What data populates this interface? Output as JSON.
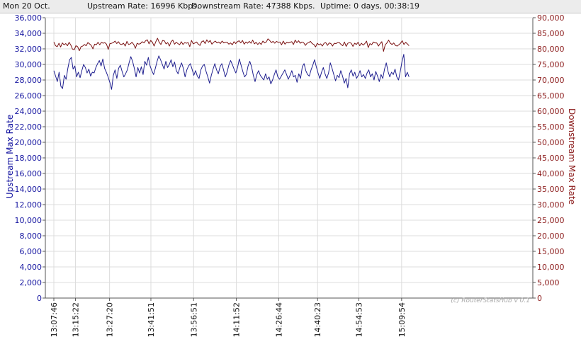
{
  "status": {
    "date": "Mon 20 Oct.",
    "upstream": "Upstream Rate: 16996 Kbps.",
    "downstream": "Downstream Rate: 47388 Kbps.",
    "uptime": "Uptime: 0 days, 00:38:19"
  },
  "credit": "(c) RouterStatsHub v 0.1",
  "colors": {
    "upstream": "#1f1f8f",
    "downstream": "#7a1010",
    "grid": "#dcdcdc"
  },
  "chart_data": {
    "type": "line",
    "title": "",
    "xlabel": "",
    "ylabel_left": "Upstream Max Rate",
    "ylabel_right": "Downstream Max Rate",
    "ylim_left": [
      0,
      36000
    ],
    "ylim_right": [
      0,
      90000
    ],
    "left_ticks": [
      "0",
      "2,000",
      "4,000",
      "6,000",
      "8,000",
      "10,000",
      "12,000",
      "14,000",
      "16,000",
      "18,000",
      "20,000",
      "22,000",
      "24,000",
      "26,000",
      "28,000",
      "30,000",
      "32,000",
      "34,000",
      "36,000"
    ],
    "right_ticks": [
      "0",
      "5,000",
      "10,000",
      "15,000",
      "20,000",
      "25,000",
      "30,000",
      "35,000",
      "40,000",
      "45,000",
      "50,000",
      "55,000",
      "60,000",
      "65,000",
      "70,000",
      "75,000",
      "80,000",
      "85,000",
      "90,000"
    ],
    "x_ticks": [
      "13:07:46",
      "13:15:22",
      "13:27:20",
      "13:41:51",
      "13:56:51",
      "14:11:52",
      "14:26:44",
      "14:40:23",
      "14:54:53",
      "15:09:54"
    ],
    "grid": true,
    "series": [
      {
        "name": "Upstream Max Rate",
        "axis": "left",
        "x_start": "13:07:46",
        "x_end": "15:12:30",
        "values": [
          29200,
          28500,
          27800,
          29000,
          27200,
          26900,
          28600,
          28100,
          29500,
          30600,
          30900,
          29400,
          29800,
          28400,
          29000,
          28300,
          29200,
          30000,
          29600,
          28900,
          29400,
          28500,
          29000,
          28900,
          29600,
          30100,
          30500,
          29800,
          30700,
          29500,
          29000,
          28400,
          27700,
          26800,
          28600,
          29300,
          28200,
          29500,
          29900,
          29100,
          28400,
          28800,
          29300,
          30200,
          31000,
          30400,
          29500,
          28400,
          29600,
          28900,
          29700,
          28700,
          30400,
          29900,
          30900,
          29800,
          29200,
          28700,
          29500,
          30400,
          31100,
          30600,
          30000,
          29400,
          30400,
          29600,
          30000,
          30600,
          29700,
          30300,
          29200,
          28800,
          29600,
          30200,
          29500,
          28400,
          29300,
          29800,
          30100,
          29400,
          28600,
          29200,
          28500,
          28200,
          29300,
          29800,
          30000,
          29100,
          28400,
          27600,
          28600,
          29400,
          30100,
          29300,
          28800,
          29700,
          30100,
          29300,
          28400,
          29000,
          29900,
          30500,
          30000,
          29400,
          28900,
          29600,
          30700,
          29900,
          29100,
          28400,
          28700,
          29800,
          30400,
          29700,
          28600,
          27800,
          28700,
          29200,
          28600,
          28300,
          28000,
          28800,
          28100,
          28400,
          27500,
          28000,
          28700,
          29300,
          28400,
          28100,
          28500,
          28900,
          29300,
          28700,
          28100,
          28600,
          29200,
          28400,
          28600,
          27700,
          28800,
          28200,
          29700,
          30100,
          29200,
          28700,
          28500,
          29300,
          29900,
          30600,
          29700,
          28900,
          28200,
          29000,
          29600,
          28800,
          28200,
          28900,
          30200,
          29500,
          28700,
          27900,
          28600,
          28300,
          29200,
          28500,
          27600,
          28200,
          27000,
          28800,
          29300,
          28500,
          29000,
          28200,
          28600,
          29200,
          28400,
          28700,
          28200,
          28900,
          29300,
          28400,
          28800,
          28000,
          29100,
          28500,
          27800,
          28700,
          28200,
          29400,
          30200,
          29100,
          28400,
          29000,
          28700,
          29400,
          28400,
          28000,
          29100,
          30400,
          31300,
          28400,
          29000,
          28400
        ]
      },
      {
        "name": "Downstream Max Rate",
        "axis": "right",
        "x_start": "13:07:46",
        "x_end": "15:12:30",
        "values": [
          82200,
          81000,
          80700,
          81800,
          80600,
          81900,
          81300,
          81700,
          81000,
          82100,
          81200,
          79900,
          79700,
          81000,
          80700,
          79400,
          80700,
          80900,
          81400,
          81000,
          82000,
          81600,
          81100,
          80000,
          81500,
          81300,
          82100,
          81300,
          82100,
          81800,
          82000,
          81500,
          79800,
          81700,
          81800,
          82000,
          82500,
          81700,
          82300,
          81500,
          81400,
          81800,
          80900,
          82400,
          81400,
          81600,
          82100,
          81400,
          80200,
          81800,
          81500,
          81700,
          82300,
          81900,
          82600,
          82900,
          81600,
          82700,
          82100,
          80900,
          82300,
          83400,
          82100,
          81400,
          82700,
          82600,
          81600,
          82000,
          80900,
          82300,
          82800,
          81500,
          82100,
          81700,
          81300,
          82300,
          81400,
          82000,
          81800,
          82000,
          80700,
          82700,
          81600,
          81900,
          82200,
          81500,
          81100,
          82300,
          82600,
          81700,
          82900,
          82100,
          82700,
          81500,
          82100,
          82500,
          81900,
          82200,
          81700,
          82500,
          81900,
          82100,
          82100,
          81500,
          81900,
          81300,
          82300,
          81700,
          82300,
          82600,
          81900,
          82700,
          81500,
          82200,
          81800,
          82400,
          81800,
          82800,
          81600,
          82100,
          81400,
          82000,
          81400,
          82500,
          81900,
          82200,
          83200,
          82700,
          82000,
          82400,
          81800,
          82400,
          82100,
          82200,
          81300,
          82500,
          81500,
          82100,
          81900,
          82100,
          82300,
          81400,
          82800,
          82000,
          82600,
          81800,
          82200,
          82000,
          81100,
          81800,
          82000,
          82400,
          81700,
          81400,
          80600,
          81800,
          81300,
          81600,
          80900,
          81800,
          82000,
          81100,
          81900,
          81700,
          80900,
          81800,
          81700,
          82000,
          82000,
          81400,
          81000,
          82200,
          80800,
          81800,
          82000,
          81800,
          80800,
          81800,
          81400,
          82100,
          81000,
          81800,
          81200,
          81700,
          82500,
          80400,
          81700,
          81300,
          82200,
          81900,
          81900,
          80900,
          81700,
          82300,
          79200,
          81300,
          81900,
          82800,
          81800,
          81400,
          81900,
          81100,
          80900,
          81300,
          81800,
          82600,
          81400,
          82100,
          81600,
          81000
        ]
      }
    ]
  }
}
